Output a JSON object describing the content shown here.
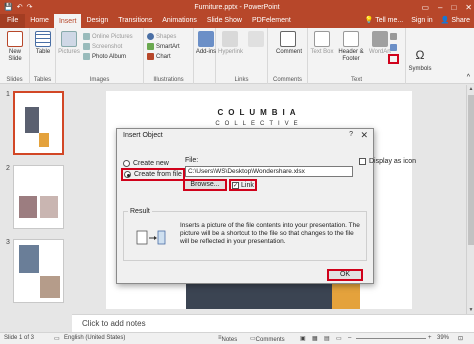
{
  "titlebar": {
    "title": "Furniture.pptx - PowerPoint",
    "undo": "↶",
    "redo": "↷",
    "save": "💾"
  },
  "tabs": [
    {
      "label": "File"
    },
    {
      "label": "Home"
    },
    {
      "label": "Insert"
    },
    {
      "label": "Design"
    },
    {
      "label": "Transitions"
    },
    {
      "label": "Animations"
    },
    {
      "label": "Slide Show"
    },
    {
      "label": "PDFelement"
    }
  ],
  "tabs_right": {
    "tell_me": "Tell me...",
    "sign_in": "Sign in",
    "share": "Share"
  },
  "ribbon": {
    "new_slide": "New Slide",
    "table": "Table",
    "slides_group": "Slides",
    "tables_group": "Tables",
    "pictures": "Pictures",
    "online_pictures": "Online Pictures",
    "screenshot": "Screenshot",
    "photo_album": "Photo Album",
    "images_group": "Images",
    "shapes": "Shapes",
    "smartart": "SmartArt",
    "chart": "Chart",
    "illustrations_group": "Illustrations",
    "addins": "Add-ins",
    "hyperlink": "Hyperlink",
    "links_group": "Links",
    "comment": "Comment",
    "comments_group": "Comments",
    "text_box": "Text Box",
    "header_footer": "Header & Footer",
    "wordart": "WordArt",
    "text_group": "Text",
    "symbols": "Symbols"
  },
  "thumbnails": [
    {
      "num": "1"
    },
    {
      "num": "2"
    },
    {
      "num": "3"
    }
  ],
  "slide": {
    "brand_line1": "COLUMBIA",
    "brand_line2": "COLLECTIVE"
  },
  "notes_placeholder": "Click to add notes",
  "status": {
    "slide_of": "Slide 1 of 3",
    "language": "English (United States)",
    "notes": "Notes",
    "comments": "Comments",
    "zoom": "39%"
  },
  "dialog": {
    "title": "Insert Object",
    "help": "?",
    "close": "✕",
    "create_new": "Create new",
    "create_from_file": "Create from file",
    "file_label": "File:",
    "file_value": "C:\\Users\\WS\\Desktop\\Wondershare.xlsx",
    "browse": "Browse...",
    "link": "Link",
    "display_as_icon": "Display as icon",
    "result_label": "Result",
    "result_text": "Inserts a picture of the file contents into your presentation. The picture will be a shortcut to the file so that changes to the file will be reflected in your presentation.",
    "ok": "OK"
  },
  "colors": {
    "accent": "#b7472a",
    "highlight": "#d0021b"
  }
}
